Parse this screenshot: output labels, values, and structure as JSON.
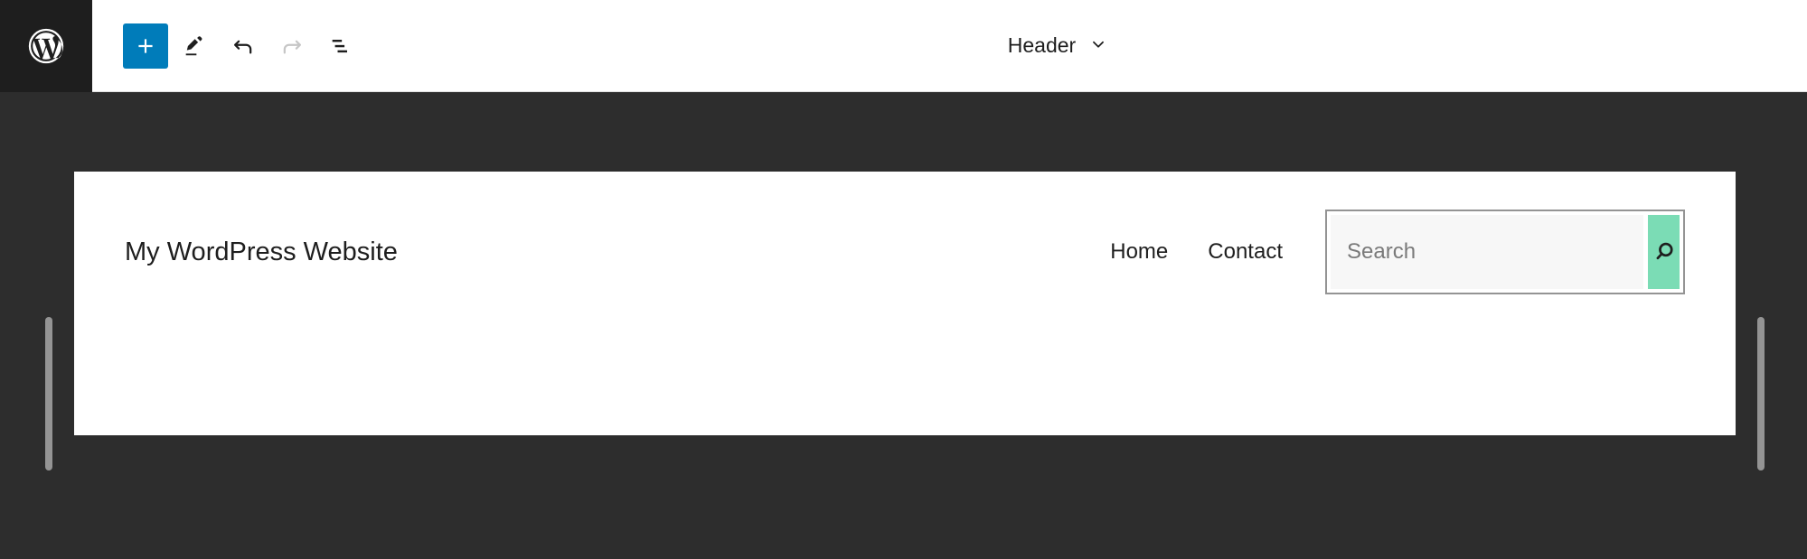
{
  "editor": {
    "logo_icon": "wordpress-logo-icon",
    "toolbar": {
      "add_block_label": "+",
      "add_block_icon": "plus-icon",
      "edit_tool_icon": "pencil-icon",
      "undo_icon": "undo-arrow-icon",
      "redo_icon": "redo-arrow-icon",
      "list_view_icon": "list-view-icon"
    },
    "document_switcher": {
      "label": "Header",
      "chevron_icon": "chevron-down-icon"
    },
    "colors": {
      "primary_blue": "#007CBA",
      "canvas_background": "#2D2D2D",
      "logo_block": "#1E1E1E",
      "search_button_green": "#7BDCB5",
      "selection_border": "#949494"
    },
    "resize_handles": {
      "left": "resize-handle-left",
      "right": "resize-handle-right"
    }
  },
  "header_block": {
    "site_title": "My WordPress Website",
    "navigation": [
      {
        "label": "Home"
      },
      {
        "label": "Contact"
      }
    ],
    "search": {
      "placeholder": "Search",
      "value": "",
      "button_icon": "magnifier-icon"
    }
  }
}
